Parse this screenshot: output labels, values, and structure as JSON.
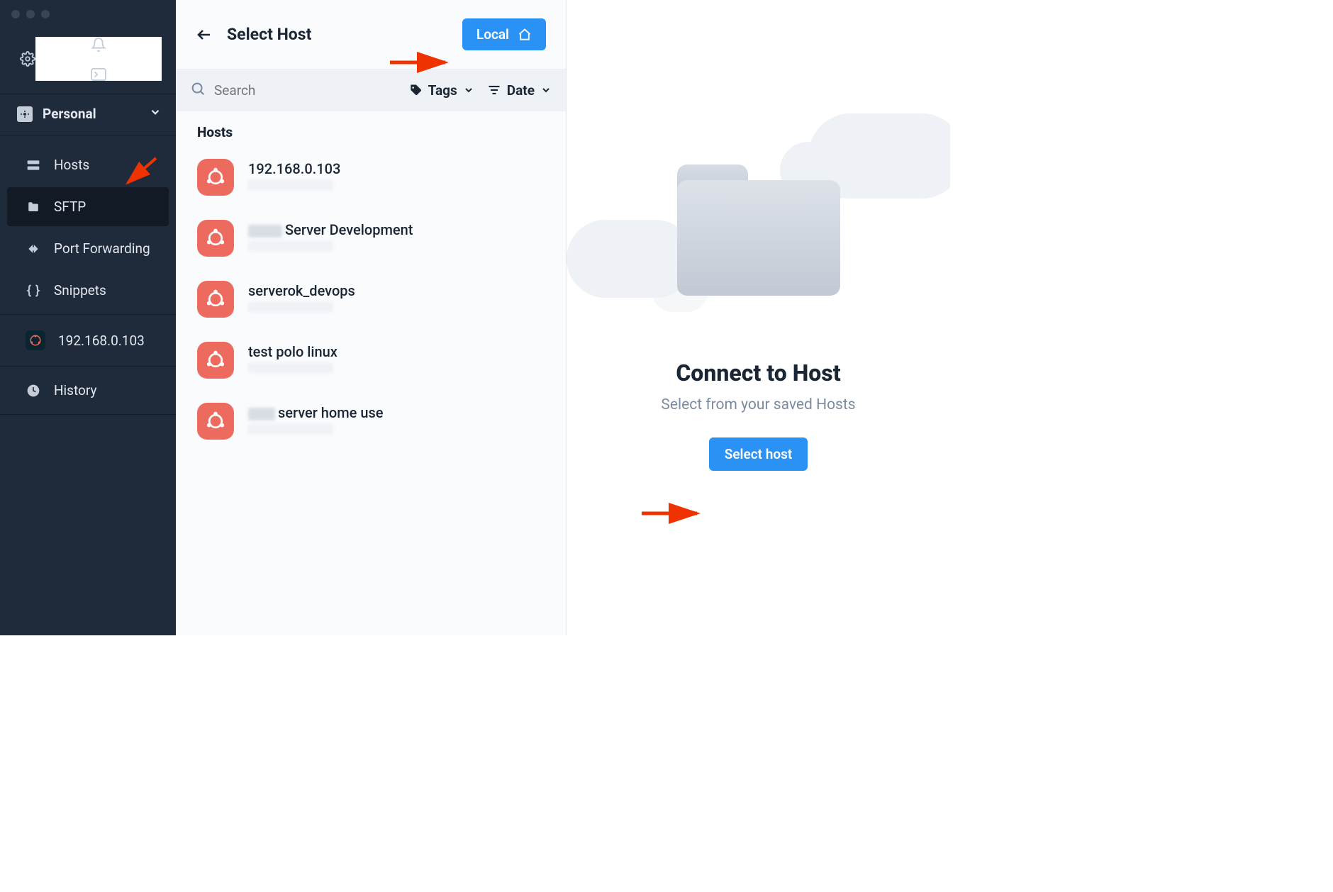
{
  "sidebar": {
    "workspace_label": "Personal",
    "nav": {
      "hosts": "Hosts",
      "sftp": "SFTP",
      "port_forwarding": "Port Forwarding",
      "snippets": "Snippets",
      "history": "History"
    },
    "connection_label": "192.168.0.103"
  },
  "mid": {
    "title": "Select Host",
    "local_button": "Local",
    "search_placeholder": "Search",
    "tags_label": "Tags",
    "date_label": "Date",
    "hosts_heading": "Hosts",
    "hosts": [
      {
        "title_prefix": "",
        "title": "192.168.0.103"
      },
      {
        "title_prefix": "blur",
        "title": "Server Development"
      },
      {
        "title_prefix": "",
        "title": "serverok_devops"
      },
      {
        "title_prefix": "",
        "title": "test polo linux"
      },
      {
        "title_prefix": "blur",
        "title": "server home use"
      }
    ]
  },
  "right": {
    "title": "Connect to Host",
    "subtitle": "Select from your saved Hosts",
    "select_button": "Select host"
  }
}
